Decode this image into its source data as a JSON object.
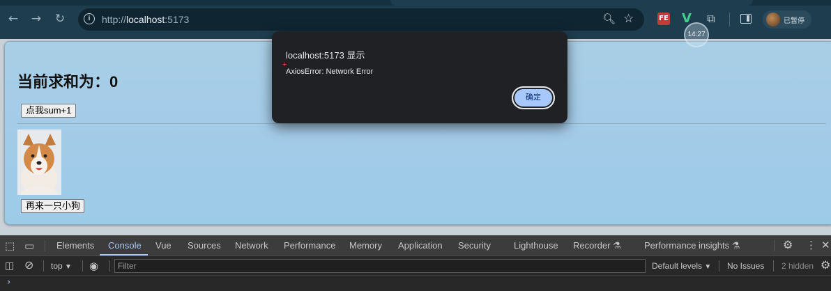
{
  "browser": {
    "url_prefix": "http://",
    "url_host": "localhost",
    "url_suffix": ":5173",
    "profile_name": "已暂停",
    "clock": "14:27",
    "icons": [
      "back-icon",
      "forward-icon",
      "reload-icon",
      "info-icon",
      "zoom-icon",
      "star-icon",
      "extensions-icon",
      "side-panel-icon"
    ]
  },
  "page": {
    "sum_label": "当前求和为：0",
    "add_button": "点我sum+1",
    "dog_button": "再来一只小狗"
  },
  "dialog": {
    "title": "localhost:5173 显示",
    "message": "AxiosError: Network Error",
    "ok_label": "确定"
  },
  "devtools": {
    "tabs": [
      "Elements",
      "Console",
      "Vue",
      "Sources",
      "Network",
      "Performance",
      "Memory",
      "Application",
      "Security",
      "Lighthouse",
      "Recorder ⚗",
      "Performance insights ⚗"
    ],
    "active_tab": "Console",
    "context": "top",
    "filter_placeholder": "Filter",
    "levels": "Default levels",
    "issues": "No Issues",
    "hidden": "2 hidden",
    "prompt": "›"
  }
}
